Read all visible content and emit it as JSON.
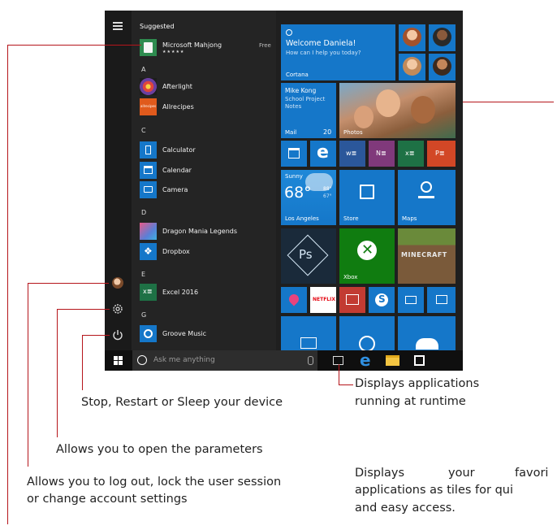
{
  "start_menu": {
    "suggested_label": "Suggested",
    "suggested_app": {
      "name": "Microsoft Mahjong",
      "stars": "★★★★★",
      "price": "Free"
    },
    "groups": [
      {
        "letter": "A",
        "apps": [
          "Afterlight",
          "Allrecipes"
        ]
      },
      {
        "letter": "C",
        "apps": [
          "Calculator",
          "Calendar",
          "Camera"
        ]
      },
      {
        "letter": "D",
        "apps": [
          "Dragon Mania Legends",
          "Dropbox"
        ]
      },
      {
        "letter": "E",
        "apps": [
          "Excel 2016"
        ]
      },
      {
        "letter": "G",
        "apps": [
          "Groove Music"
        ]
      }
    ],
    "allrecipes_icon_text": "allrecipes"
  },
  "tiles": {
    "cortana": {
      "greeting": "Welcome Daniela!",
      "prompt": "How can I help you today?",
      "name": "Cortana"
    },
    "mail": {
      "sender": "Mike Kong",
      "line1": "School Project",
      "line2": "Notes",
      "label": "Mail",
      "count": "20"
    },
    "photos": {
      "label": "Photos"
    },
    "weather": {
      "condition": "Sunny",
      "temp": "68°",
      "unit": "F",
      "high": "88°",
      "low": "67°",
      "city": "Los Angeles"
    },
    "store": {
      "label": "Store"
    },
    "maps": {
      "label": "Maps"
    },
    "xbox": {
      "label": "Xbox"
    },
    "minecraft": {
      "label": "MINECRAFT"
    },
    "netflix": {
      "label": "NETFLIX"
    },
    "photoshop": {
      "label": "Ps"
    }
  },
  "taskbar": {
    "search_placeholder": "Ask me anything"
  },
  "annotations": {
    "power": "Stop, Restart or Sleep your device",
    "task_view_1": "Displays applications",
    "task_view_2": "running at runtime",
    "settings": "Allows you to open the parameters",
    "user_1": "Allows you to log out, lock the user session",
    "user_2": "or change account settings",
    "tiles_1a": "Displays",
    "tiles_1b": "your",
    "tiles_1c": "favori",
    "tiles_2": "applications as tiles for qui",
    "tiles_3": "and easy access."
  },
  "colors": {
    "accent": "#1577c9",
    "callout_line": "#b5151b",
    "taskbar": "#0f0f0f"
  }
}
